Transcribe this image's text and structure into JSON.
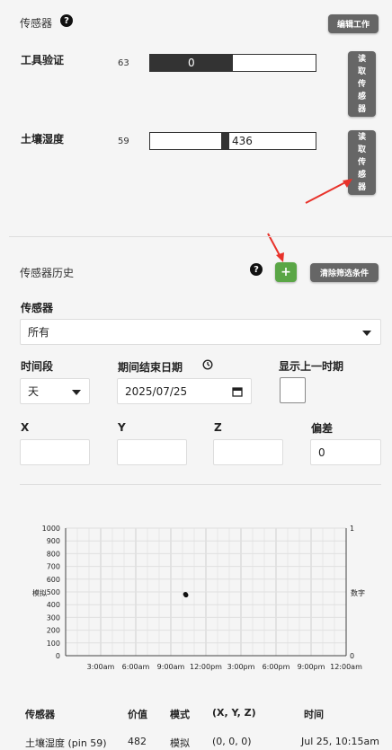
{
  "header": {
    "title": "传感器",
    "edit_label": "编辑工作"
  },
  "sensors": [
    {
      "name": "工具验证",
      "pin": "63",
      "value": "0",
      "fraction": 0.5,
      "read_label": [
        "读",
        "取",
        "传",
        "感",
        "器"
      ]
    },
    {
      "name": "土壤湿度",
      "pin": "59",
      "value": "436",
      "fraction": 0.43,
      "read_label": [
        "读",
        "取",
        "传",
        "感",
        "器"
      ]
    }
  ],
  "history": {
    "title": "传感器历史",
    "add_label": "+",
    "clear_label": "清除筛选条件",
    "sensor_label": "传感器",
    "sensor_value": "所有",
    "period_label": "时间段",
    "period_value": "天",
    "end_date_label": "期间结束日期",
    "end_date_value": "2025/07/25",
    "show_prev_label": "显示上一时期",
    "x_label": "X",
    "y_label": "Y",
    "z_label": "Z",
    "offset_label": "偏差",
    "offset_value": "0"
  },
  "chart_data": {
    "type": "scatter",
    "ylabel": "模拟",
    "y2label": "数字",
    "ylim": [
      0,
      1000
    ],
    "y2lim": [
      0,
      1
    ],
    "yticks": [
      "1000",
      "900",
      "800",
      "700",
      "600",
      "500",
      "400",
      "300",
      "200",
      "100",
      "0"
    ],
    "y2ticks": [
      "1",
      "0"
    ],
    "xticks": [
      "3:00am",
      "6:00am",
      "9:00am",
      "12:00pm",
      "3:00pm",
      "6:00pm",
      "9:00pm",
      "12:00am"
    ],
    "xlim_hours": [
      0,
      24
    ],
    "points": [
      {
        "x_hours": 10.25,
        "y": 482
      },
      {
        "x_hours": 10.3,
        "y": 475
      }
    ]
  },
  "table": {
    "headers": [
      "传感器",
      "价值",
      "模式",
      "(X, Y, Z)",
      "时间"
    ],
    "rows": [
      [
        "土壤湿度 (pin 59)",
        "482",
        "模拟",
        "(0, 0, 0)",
        "Jul 25, 10:15am"
      ]
    ]
  }
}
